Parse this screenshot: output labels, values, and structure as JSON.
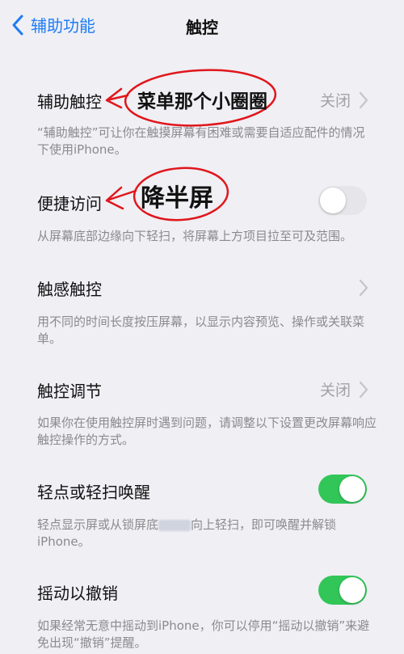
{
  "nav": {
    "back_label": "辅助功能",
    "title": "触控"
  },
  "rows": [
    {
      "label": "辅助触控",
      "value": "关闭",
      "footer": "“辅助触控”可让你在触摸屏幕有困难或需要自适应配件的情况下使用iPhone。"
    },
    {
      "label": "便捷访问",
      "toggle": false,
      "footer": "从屏幕底部边缘向下轻扫，将屏幕上方项目拉至可及范围。"
    },
    {
      "label": "触感触控",
      "footer": "用不同的时间长度按压屏幕，以显示内容预览、操作或关联菜单。"
    },
    {
      "label": "触控调节",
      "value": "关闭",
      "footer": "如果你在使用触控屏时遇到问题，请调整以下设置更改屏幕响应触控操作的方式。"
    },
    {
      "label": "轻点或轻扫唤醒",
      "toggle": true,
      "footer_part1": "轻点显示屏或从锁屏底",
      "footer_part2": "向上轻扫，即可唤醒并解锁iPhone。"
    },
    {
      "label": "摇动以撤销",
      "toggle": true,
      "footer": "如果经常无意中摇动到iPhone，你可以停用“摇动以撤销”来避免出现“撤销”提醒。"
    }
  ],
  "annotations": {
    "menu_circle": "菜单那个小圈圈",
    "half_screen": "降半屏"
  },
  "colors": {
    "accent": "#1e7cf5",
    "toggle_on": "#32c659",
    "annotation_ink": "#e0161b"
  }
}
